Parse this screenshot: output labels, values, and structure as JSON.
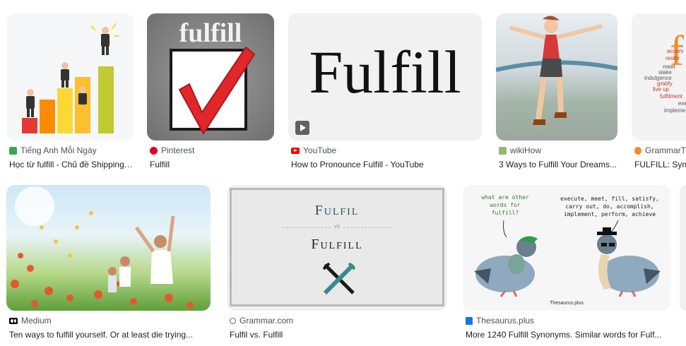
{
  "results": [
    {
      "source": "Tiếng Anh Mỗi Ngày",
      "title": "Học từ fulfill - Chủ đề Shipping ..."
    },
    {
      "source": "Pinterest",
      "title": "Fulfill",
      "thumb_text": "fulfill"
    },
    {
      "source": "YouTube",
      "title": "How to Pronounce Fulfill - YouTube",
      "thumb_text": "Fulfill"
    },
    {
      "source": "wikiHow",
      "title": "3 Ways to Fulfill Your Dreams..."
    },
    {
      "source": "GrammarT",
      "title": "FULFILL: Syn",
      "thumb_words": [
        "accom",
        "restor",
        "meet",
        "slake",
        "indulgence",
        "gratify",
        "live up",
        "fulfilment",
        "exe",
        "impleme"
      ]
    },
    {
      "source": "Medium",
      "title": "Ten ways to fulfill yourself. Or at least die trying..."
    },
    {
      "source": "Grammar.com",
      "title": "Fulfil vs. Fulfill",
      "thumb_word1": "Fulfil",
      "thumb_vs": "vs",
      "thumb_word2": "Fulfill"
    },
    {
      "source": "Thesaurus.plus",
      "title": "More 1240 Fulfill Synonyms. Similar words for Fulf...",
      "bubble_left": [
        "what are other",
        "words for",
        "fulfill?"
      ],
      "bubble_right": [
        "execute, meet, fill, satisfy,",
        "carry out, do, accomplish,",
        "implement, perform, achieve"
      ],
      "watermark": "Thesaurus.plus"
    }
  ],
  "colors": {
    "youtube": "#ff0000",
    "pinterest": "#e60023",
    "wikihow": "#93b874",
    "grammartop": "#f58a25",
    "medium": "#000000",
    "thesaurus": "#1a73e8",
    "vietnam": "#34a853"
  }
}
